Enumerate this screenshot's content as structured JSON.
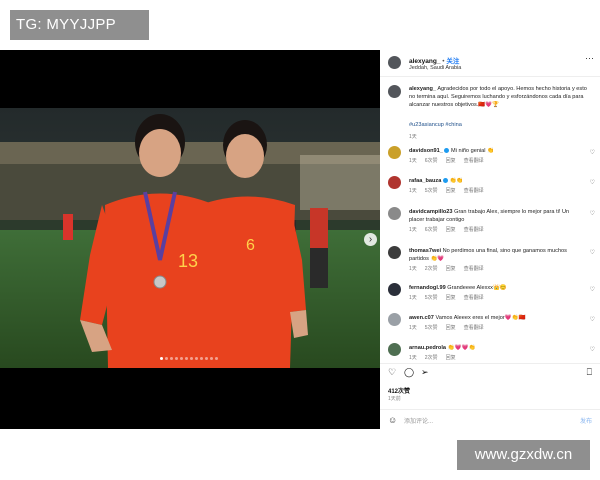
{
  "watermarks": {
    "top": "TG: MYYJJPP",
    "bottom": "www.gzxdw.cn"
  },
  "post": {
    "author": "alexyang_",
    "separator": "•",
    "follow_label": "关注",
    "location": "Jeddah, Saudi Arabia",
    "more_icon": "ellipsis-icon",
    "next_icon": "chevron-right-icon",
    "carousel": {
      "count": 12,
      "active": 0
    },
    "photo_jersey_numbers": [
      "13",
      "6"
    ],
    "caption_author": "alexyang_",
    "caption_text": "Agradecidos por todo el apoyo. Hemos hecho historia y esto no termina aquí. Seguiremos luchando y esforzándonos cada día para alcanzar nuestros objetivos.🇨🇳💗🏆",
    "hashtags": "#u23asiancup #china",
    "caption_time": "1天"
  },
  "comments": [
    {
      "user": "davidson91_",
      "verified": true,
      "text": "Mi niño genial 👏",
      "time": "1天",
      "likes": "6次赞",
      "reply": "回复",
      "translate": "查看翻译",
      "avatar_color": "#caa02a"
    },
    {
      "user": "rafaa_bauza",
      "verified": true,
      "text": "👏👏",
      "time": "1天",
      "likes": "5次赞",
      "reply": "回复",
      "translate": "查看翻译",
      "avatar_color": "#b0352f"
    },
    {
      "user": "davidcampillo23",
      "verified": false,
      "text": "Gran trabajo Alex, siempre lo mejor para ti! Un placer trabajar contigo",
      "time": "1天",
      "likes": "6次赞",
      "reply": "回复",
      "translate": "查看翻译",
      "avatar_color": "#8a8a8a"
    },
    {
      "user": "thomas7wei",
      "verified": false,
      "text": "No perdimos una final, sino que ganamos muchos partidos 👏💗",
      "time": "1天",
      "likes": "2次赞",
      "reply": "回复",
      "translate": "查看翻译",
      "avatar_color": "#3c3c3c"
    },
    {
      "user": "fernandogl.99",
      "verified": false,
      "text": "Grandeeee Alexxx👑😊",
      "time": "1天",
      "likes": "5次赞",
      "reply": "回复",
      "translate": "查看翻译",
      "avatar_color": "#2b2f3a"
    },
    {
      "user": "awen.c07",
      "verified": false,
      "text": "Vamos Aleeex eres el mejor💗👏🇨🇳",
      "time": "1天",
      "likes": "5次赞",
      "reply": "回复",
      "translate": "查看翻译",
      "avatar_color": "#9aa0a6"
    },
    {
      "user": "arnau.pedrola",
      "verified": false,
      "text": "👏💗💗👏",
      "time": "1天",
      "likes": "2次赞",
      "reply": "回复",
      "translate": "",
      "avatar_color": "#4f6f52"
    }
  ],
  "actions": {
    "like_icon": "heart-icon",
    "comment_icon": "comment-icon",
    "share_icon": "share-icon",
    "save_icon": "bookmark-icon"
  },
  "likes": "412次赞",
  "date": "1天前",
  "add_comment": {
    "icon": "smiley-icon",
    "placeholder": "添加评论...",
    "post_label": "发布"
  },
  "colors": {
    "jersey": "#e8421e",
    "link": "#1d4e89",
    "follow": "#1877f2"
  }
}
